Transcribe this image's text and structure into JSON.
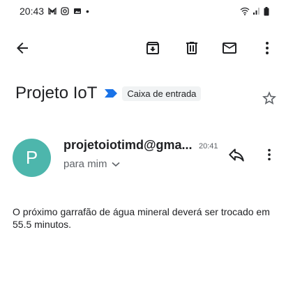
{
  "status_bar": {
    "time": "20:43",
    "notification_icons": [
      "gmail-icon",
      "instagram-icon",
      "gallery-icon"
    ],
    "dot": "•"
  },
  "toolbar": {
    "back_icon": "arrow-back-icon",
    "archive_icon": "archive-icon",
    "delete_icon": "delete-icon",
    "mail_icon": "mark-unread-icon",
    "more_icon": "more-vert-icon"
  },
  "email": {
    "subject": "Projeto IoT",
    "label": "Caixa de entrada",
    "sender": "projetoiotimd@gma...",
    "avatar_letter": "P",
    "time": "20:41",
    "recipient": "para mim",
    "body": "O próximo garrafão de água mineral deverá ser trocado em 55.5 minutos."
  },
  "colors": {
    "avatar": "#4db6ac",
    "important_marker": "#1a73e8",
    "chip_background": "#f1f3f4",
    "secondary_text": "#5f6368"
  }
}
